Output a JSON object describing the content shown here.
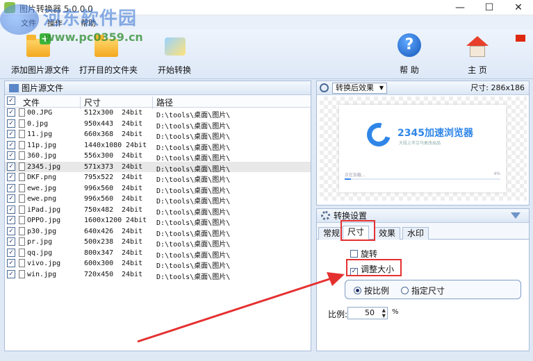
{
  "window": {
    "title": "图片转换器 5.0.0.0",
    "minimize": "—",
    "maximize": "☐",
    "close": "✕"
  },
  "watermark": {
    "name": "河东软件园",
    "url": "www.pc0359.cn"
  },
  "menu": [
    "文件",
    "操作",
    "帮助"
  ],
  "toolbar": {
    "add_source": "添加图片源文件",
    "open_target": "打开目的文件夹",
    "start": "开始转换",
    "help": "帮 助",
    "home": "主 页",
    "help_glyph": "?"
  },
  "file_panel": {
    "title": "图片源文件",
    "columns": [
      "文件",
      "尺寸",
      "路径"
    ],
    "rows": [
      {
        "name": "00.JPG",
        "size": "512x300",
        "depth": "24bit",
        "path": "D:\\tools\\桌面\\图片\\",
        "checked": true
      },
      {
        "name": "0.jpg",
        "size": "950x443",
        "depth": "24bit",
        "path": "D:\\tools\\桌面\\图片\\",
        "checked": true
      },
      {
        "name": "11.jpg",
        "size": "660x368",
        "depth": "24bit",
        "path": "D:\\tools\\桌面\\图片\\",
        "checked": true
      },
      {
        "name": "11p.jpg",
        "size": "1440x1080",
        "depth": "24bit",
        "path": "D:\\tools\\桌面\\图片\\",
        "checked": true
      },
      {
        "name": "360.jpg",
        "size": "556x300",
        "depth": "24bit",
        "path": "D:\\tools\\桌面\\图片\\",
        "checked": true
      },
      {
        "name": "2345.jpg",
        "size": "571x373",
        "depth": "24bit",
        "path": "D:\\tools\\桌面\\图片\\",
        "checked": true
      },
      {
        "name": "DKF.png",
        "size": "795x522",
        "depth": "24bit",
        "path": "D:\\tools\\桌面\\图片\\",
        "checked": true
      },
      {
        "name": "ewe.jpg",
        "size": "996x560",
        "depth": "24bit",
        "path": "D:\\tools\\桌面\\图片\\",
        "checked": true
      },
      {
        "name": "ewe.png",
        "size": "996x560",
        "depth": "24bit",
        "path": "D:\\tools\\桌面\\图片\\",
        "checked": true
      },
      {
        "name": "iPad.jpg",
        "size": "750x482",
        "depth": "24bit",
        "path": "D:\\tools\\桌面\\图片\\",
        "checked": true
      },
      {
        "name": "OPPO.jpg",
        "size": "1600x1200",
        "depth": "24bit",
        "path": "D:\\tools\\桌面\\图片\\",
        "checked": true
      },
      {
        "name": "p30.jpg",
        "size": "640x426",
        "depth": "24bit",
        "path": "D:\\tools\\桌面\\图片\\",
        "checked": true
      },
      {
        "name": "pr.jpg",
        "size": "500x238",
        "depth": "24bit",
        "path": "D:\\tools\\桌面\\图片\\",
        "checked": true
      },
      {
        "name": "qq.jpg",
        "size": "800x347",
        "depth": "24bit",
        "path": "D:\\tools\\桌面\\图片\\",
        "checked": true
      },
      {
        "name": "vivo.jpg",
        "size": "600x300",
        "depth": "24bit",
        "path": "D:\\tools\\桌面\\图片\\",
        "checked": true
      },
      {
        "name": "win.jpg",
        "size": "720x450",
        "depth": "24bit",
        "path": "D:\\tools\\桌面\\图片\\",
        "checked": true
      }
    ]
  },
  "preview": {
    "mode": "转换后效果",
    "size_label": "尺寸: 286x186",
    "brand": "2345加速浏览器",
    "brand_sub": "大段上市立马更改出品",
    "load_text": "正在加载...",
    "load_pct": "4%",
    "load_fraction": 0.04
  },
  "settings": {
    "title": "转换设置",
    "tabs": [
      "常规",
      "尺寸",
      "效果",
      "水印"
    ],
    "active_tab": "尺寸",
    "rotate": "旋转",
    "resize": "调整大小",
    "by_ratio": "按比例",
    "by_size": "指定尺寸",
    "ratio_label": "比例:",
    "ratio_value": "50",
    "ratio_unit": "%"
  },
  "colors": {
    "highlight": "#e53030",
    "accent": "#2f86e8"
  }
}
